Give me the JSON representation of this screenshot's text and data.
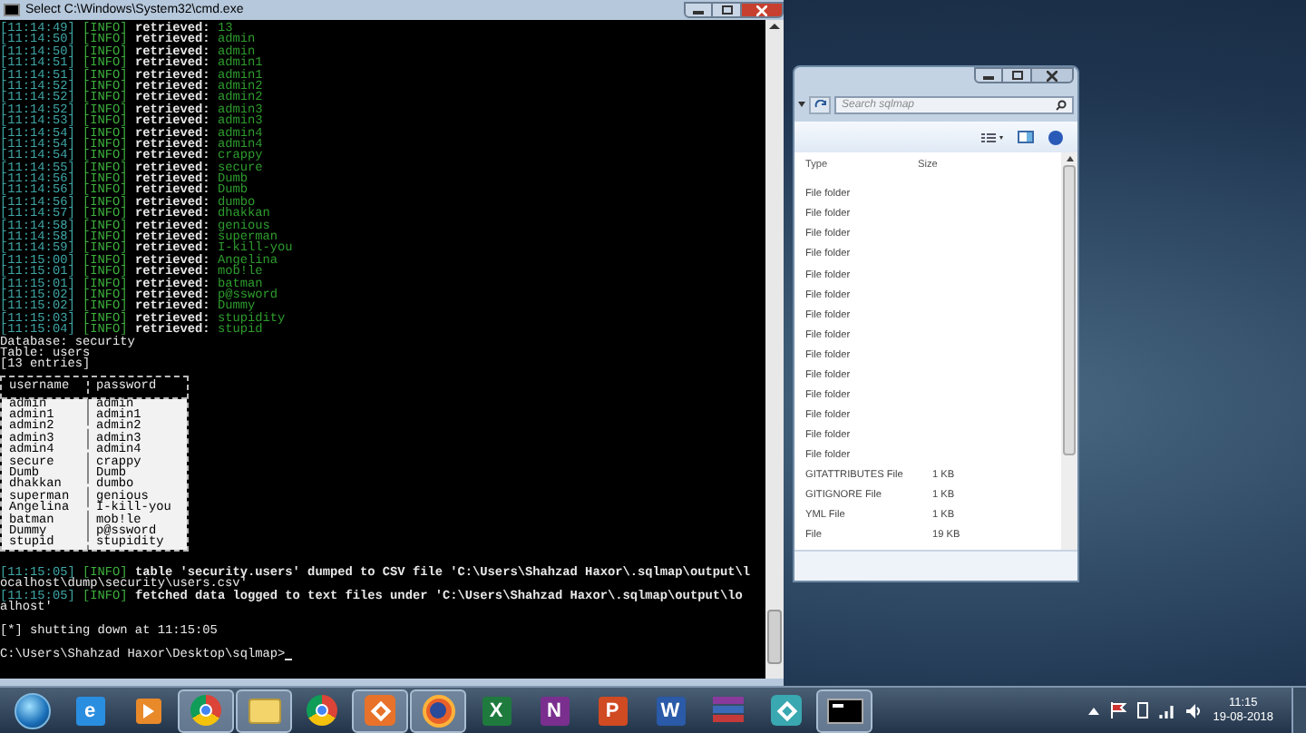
{
  "console_window": {
    "title": "Select C:\\Windows\\System32\\cmd.exe",
    "lines": [
      {
        "kind": "log",
        "time": "[11:14:49]",
        "level": "[INFO]",
        "message": "retrieved:",
        "value": "13"
      },
      {
        "kind": "log",
        "time": "[11:14:50]",
        "level": "[INFO]",
        "message": "retrieved:",
        "value": "admin"
      },
      {
        "kind": "log",
        "time": "[11:14:50]",
        "level": "[INFO]",
        "message": "retrieved:",
        "value": "admin"
      },
      {
        "kind": "log",
        "time": "[11:14:51]",
        "level": "[INFO]",
        "message": "retrieved:",
        "value": "admin1"
      },
      {
        "kind": "log",
        "time": "[11:14:51]",
        "level": "[INFO]",
        "message": "retrieved:",
        "value": "admin1"
      },
      {
        "kind": "log",
        "time": "[11:14:52]",
        "level": "[INFO]",
        "message": "retrieved:",
        "value": "admin2"
      },
      {
        "kind": "log",
        "time": "[11:14:52]",
        "level": "[INFO]",
        "message": "retrieved:",
        "value": "admin2"
      },
      {
        "kind": "log",
        "time": "[11:14:52]",
        "level": "[INFO]",
        "message": "retrieved:",
        "value": "admin3"
      },
      {
        "kind": "log",
        "time": "[11:14:53]",
        "level": "[INFO]",
        "message": "retrieved:",
        "value": "admin3"
      },
      {
        "kind": "log",
        "time": "[11:14:54]",
        "level": "[INFO]",
        "message": "retrieved:",
        "value": "admin4"
      },
      {
        "kind": "log",
        "time": "[11:14:54]",
        "level": "[INFO]",
        "message": "retrieved:",
        "value": "admin4"
      },
      {
        "kind": "log",
        "time": "[11:14:54]",
        "level": "[INFO]",
        "message": "retrieved:",
        "value": "crappy"
      },
      {
        "kind": "log",
        "time": "[11:14:55]",
        "level": "[INFO]",
        "message": "retrieved:",
        "value": "secure"
      },
      {
        "kind": "log",
        "time": "[11:14:56]",
        "level": "[INFO]",
        "message": "retrieved:",
        "value": "Dumb"
      },
      {
        "kind": "log",
        "time": "[11:14:56]",
        "level": "[INFO]",
        "message": "retrieved:",
        "value": "Dumb"
      },
      {
        "kind": "log",
        "time": "[11:14:56]",
        "level": "[INFO]",
        "message": "retrieved:",
        "value": "dumbo"
      },
      {
        "kind": "log",
        "time": "[11:14:57]",
        "level": "[INFO]",
        "message": "retrieved:",
        "value": "dhakkan"
      },
      {
        "kind": "log",
        "time": "[11:14:58]",
        "level": "[INFO]",
        "message": "retrieved:",
        "value": "genious"
      },
      {
        "kind": "log",
        "time": "[11:14:58]",
        "level": "[INFO]",
        "message": "retrieved:",
        "value": "superman"
      },
      {
        "kind": "log",
        "time": "[11:14:59]",
        "level": "[INFO]",
        "message": "retrieved:",
        "value": "I-kill-you"
      },
      {
        "kind": "log",
        "time": "[11:15:00]",
        "level": "[INFO]",
        "message": "retrieved:",
        "value": "Angelina"
      },
      {
        "kind": "log",
        "time": "[11:15:01]",
        "level": "[INFO]",
        "message": "retrieved:",
        "value": "mob!le"
      },
      {
        "kind": "log",
        "time": "[11:15:01]",
        "level": "[INFO]",
        "message": "retrieved:",
        "value": "batman"
      },
      {
        "kind": "log",
        "time": "[11:15:02]",
        "level": "[INFO]",
        "message": "retrieved:",
        "value": "p@ssword"
      },
      {
        "kind": "log",
        "time": "[11:15:02]",
        "level": "[INFO]",
        "message": "retrieved:",
        "value": "Dummy"
      },
      {
        "kind": "log",
        "time": "[11:15:03]",
        "level": "[INFO]",
        "message": "retrieved:",
        "value": "stupidity"
      },
      {
        "kind": "log",
        "time": "[11:15:04]",
        "level": "[INFO]",
        "message": "retrieved:",
        "value": "stupid"
      },
      {
        "kind": "text",
        "text": "Database: security"
      },
      {
        "kind": "text",
        "text": "Table: users"
      },
      {
        "kind": "text",
        "text": "[13 entries]"
      },
      {
        "kind": "table",
        "columns": [
          "username",
          "password"
        ],
        "rows": [
          {
            "cells": [
              "admin",
              "admin"
            ],
            "selected": true
          },
          {
            "cells": [
              "admin1",
              "admin1"
            ],
            "selected": true
          },
          {
            "cells": [
              "admin2",
              "admin2"
            ],
            "selected": true
          },
          {
            "cells": [
              "admin3",
              "admin3"
            ],
            "selected": true
          },
          {
            "cells": [
              "admin4",
              "admin4"
            ],
            "selected": true
          },
          {
            "cells": [
              "secure",
              "crappy"
            ],
            "selected": true
          },
          {
            "cells": [
              "Dumb",
              "Dumb"
            ],
            "selected": true
          },
          {
            "cells": [
              "dhakkan",
              "dumbo"
            ],
            "selected": true
          },
          {
            "cells": [
              "superman",
              "genious"
            ],
            "selected": true
          },
          {
            "cells": [
              "Angelina",
              "I-kill-you"
            ],
            "selected": true
          },
          {
            "cells": [
              "batman",
              "mob!le"
            ],
            "selected": true
          },
          {
            "cells": [
              "Dummy",
              "p@ssword"
            ],
            "selected": true
          },
          {
            "cells": [
              "stupid",
              "stupidity"
            ],
            "selected": true
          }
        ]
      },
      {
        "kind": "blank"
      },
      {
        "kind": "log",
        "time": "[11:15:05]",
        "level": "[INFO]",
        "message": "table 'security.users' dumped to CSV file 'C:\\Users\\Shahzad Haxor\\.sqlmap\\output\\l"
      },
      {
        "kind": "text",
        "text": "ocalhost\\dump\\security\\users.csv'"
      },
      {
        "kind": "log",
        "time": "[11:15:05]",
        "level": "[INFO]",
        "message": "fetched data logged to text files under 'C:\\Users\\Shahzad Haxor\\.sqlmap\\output\\lo"
      },
      {
        "kind": "text",
        "text": "alhost'"
      },
      {
        "kind": "blank"
      },
      {
        "kind": "text",
        "text": "[*] shutting down at 11:15:05"
      },
      {
        "kind": "blank"
      },
      {
        "kind": "prompt",
        "text": "C:\\Users\\Shahzad Haxor\\Desktop\\sqlmap>"
      }
    ]
  },
  "explorer_window": {
    "search": {
      "placeholder": "Search sqlmap"
    },
    "columns": [
      "Type",
      "Size"
    ],
    "rows": [
      {
        "type": "File folder"
      },
      {
        "type": "File folder"
      },
      {
        "type": "File folder"
      },
      {
        "type": "File folder"
      },
      {
        "type": "File folder"
      },
      {
        "type": "File folder"
      },
      {
        "type": "File folder"
      },
      {
        "type": "File folder"
      },
      {
        "type": "File folder"
      },
      {
        "type": "File folder"
      },
      {
        "type": "File folder"
      },
      {
        "type": "File folder"
      },
      {
        "type": "File folder"
      },
      {
        "type": "File folder"
      },
      {
        "type": "GITATTRIBUTES File",
        "size": "1 KB"
      },
      {
        "type": "GITIGNORE File",
        "size": "1 KB"
      },
      {
        "type": "YML File",
        "size": "1 KB"
      },
      {
        "type": "File",
        "size": "19 KB"
      }
    ]
  },
  "taskbar": {
    "apps": [
      {
        "kind": "orb",
        "active": false
      },
      {
        "kind": "letter",
        "glyph": "e",
        "color": "#2a8ee0",
        "active": false
      },
      {
        "kind": "media",
        "color": "#e8892a",
        "active": false
      },
      {
        "kind": "ring",
        "active": true
      },
      {
        "kind": "folder",
        "active": true
      },
      {
        "kind": "ring",
        "active": false
      },
      {
        "kind": "tile",
        "color": "#e8722a",
        "active": true
      },
      {
        "kind": "globe",
        "color": "#e8602a",
        "active": true
      },
      {
        "kind": "letter",
        "glyph": "X",
        "color": "#1f7a3e",
        "active": false
      },
      {
        "kind": "letter",
        "glyph": "N",
        "color": "#7a2f8f",
        "active": false
      },
      {
        "kind": "letter",
        "glyph": "P",
        "color": "#d04a22",
        "active": false
      },
      {
        "kind": "letter",
        "glyph": "W",
        "color": "#2a5aa8",
        "active": false
      },
      {
        "kind": "books",
        "active": false
      },
      {
        "kind": "tile",
        "color": "#3aa8b0",
        "active": false
      },
      {
        "kind": "terminal",
        "active": true
      }
    ],
    "clock": {
      "time": "11:15",
      "date": "19-08-2018"
    }
  }
}
